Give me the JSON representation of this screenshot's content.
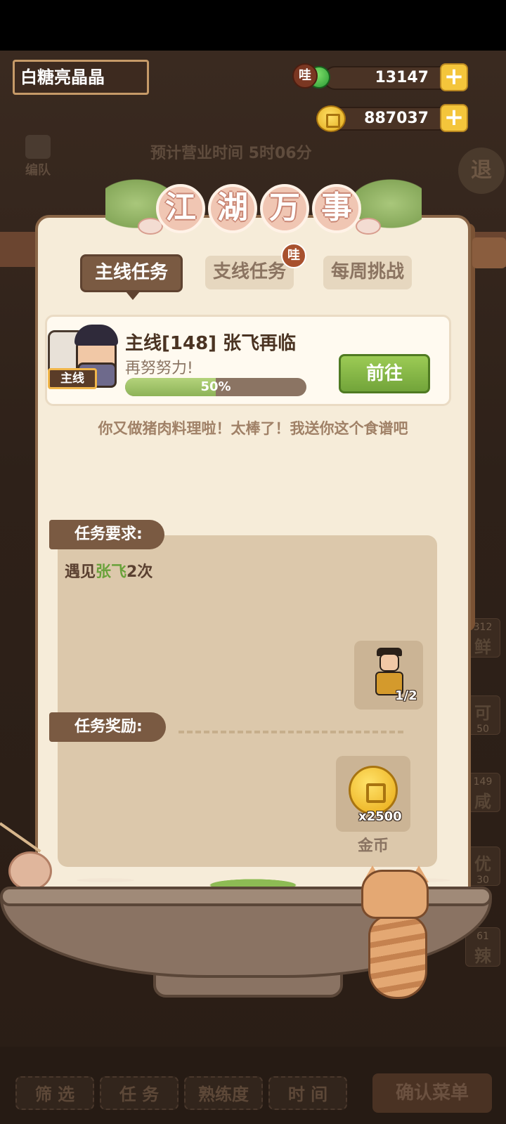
{
  "header": {
    "player_name": "白糖亮晶晶",
    "gem_badge": "哇",
    "gems": "13147",
    "coins": "887037",
    "plus": "+"
  },
  "background": {
    "business_time": "预计营业时间  5时06分",
    "side_button": "编队",
    "round_button": "退",
    "right_cards": [
      {
        "num": "312",
        "char": "鲜"
      },
      {
        "num": "50",
        "char": "可"
      },
      {
        "num": "149",
        "char": "咸"
      },
      {
        "num": "30",
        "char": "优"
      },
      {
        "num": "61",
        "char": "辣"
      }
    ],
    "bottom_buttons": [
      "筛 选",
      "任 务",
      "熟练度",
      "时 间"
    ],
    "confirm_button": "确认菜单"
  },
  "panel": {
    "title_chars": [
      "江",
      "湖",
      "万",
      "事"
    ],
    "tabs": [
      {
        "label": "主线任务",
        "active": true
      },
      {
        "label": "支线任务",
        "active": false
      },
      {
        "label": "每周挑战",
        "active": false
      }
    ],
    "tab_badge": "哇",
    "mission": {
      "tag": "主线",
      "title": "主线[148]  张飞再临",
      "subtitle": "再努努力!",
      "progress_text": "50%",
      "progress_value": 0.5,
      "go_button": "前往"
    },
    "dialogue": "你又做猪肉料理啦！太棒了！我送你这个食谱吧",
    "requirements": {
      "header": "任务要求:",
      "text_prefix": "遇见",
      "text_highlight": "张飞",
      "text_suffix": "2次",
      "npc_count": "1/2"
    },
    "rewards": {
      "header": "任务奖励:",
      "count": "x2500",
      "label": "金币"
    }
  },
  "colors": {
    "panel_bg": "#f6ecd9",
    "header_brown": "#7a5a42",
    "go_green": "#8db358",
    "highlight_green": "#6aa23b",
    "coin_gold": "#e8a812"
  }
}
